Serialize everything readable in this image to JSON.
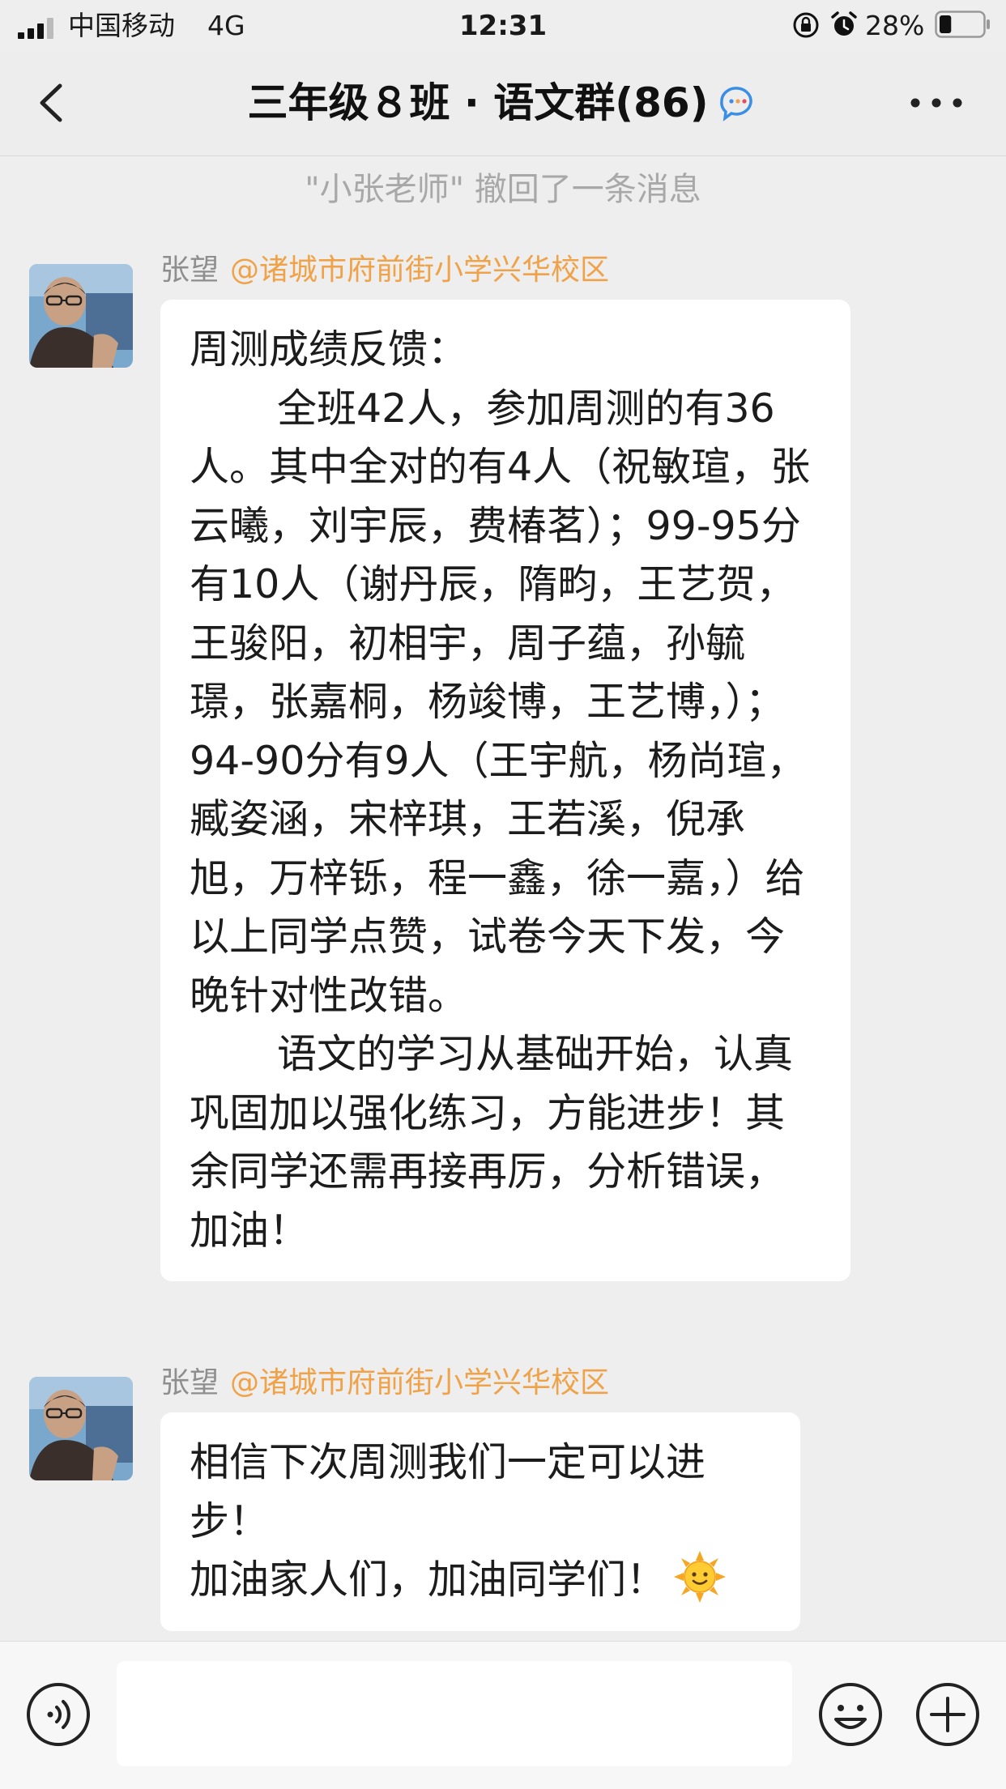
{
  "status_bar": {
    "carrier": "中国移动",
    "network": "4G",
    "time": "12:31",
    "battery_percent": "28%",
    "battery_level": 0.28
  },
  "nav": {
    "title": "三年级８班 · 语文群(86)"
  },
  "recall_notice": "\"小张老师\" 撤回了一条消息",
  "messages": [
    {
      "sender_name": "张望",
      "sender_org": "@诸城市府前街小学兴华校区",
      "lines": [
        "周测成绩反馈：",
        "全班42人，参加周测的有36人。其中全对的有4人（祝敏瑄，张云曦，刘宇辰，费椿茗）；99-95分有10人（谢丹辰，隋畇，王艺贺，王骏阳，初相宇，周子蕴，孙毓璟，张嘉桐，杨竣博，王艺博，）；94-90分有9人（王宇航，杨尚瑄，臧姿涵，宋梓琪，王若溪，倪承旭，万梓铄，程一鑫，徐一嘉，）给以上同学点赞，试卷今天下发，今晚针对性改错。",
        "语文的学习从基础开始，认真巩固加以强化练习，方能进步！其余同学还需再接再厉，分析错误，加油！"
      ]
    },
    {
      "sender_name": "张望",
      "sender_org": "@诸城市府前街小学兴华校区",
      "lines": [
        "相信下次周测我们一定可以进步！",
        "加油家人们，加油同学们！"
      ],
      "emoji": "sun-emoji"
    }
  ],
  "input_bar": {
    "text_value": "",
    "icons": [
      "voice-icon",
      "emoji-icon",
      "plus-icon"
    ]
  },
  "colors": {
    "background": "#eeeeee",
    "bubble": "#ffffff",
    "org_tag": "#f0a248",
    "sender_name": "#8e8e8e",
    "recall_text": "#a8a8a8"
  }
}
